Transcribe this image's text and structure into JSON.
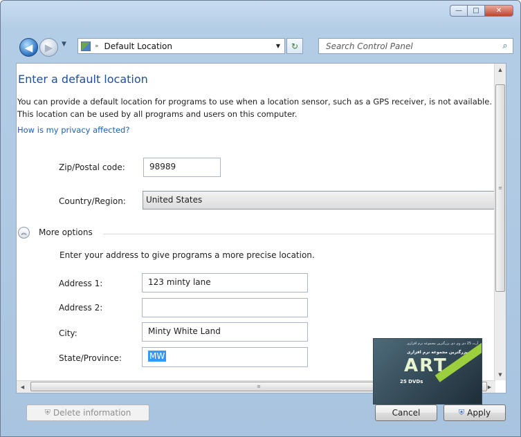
{
  "window": {
    "minimize_glyph": "—",
    "maximize_glyph": "□",
    "close_glyph": "✕"
  },
  "nav": {
    "back_glyph": "◀",
    "forward_glyph": "▶",
    "history_dropdown_glyph": "▼",
    "address_separator": "»",
    "address_text": "Default Location",
    "address_dropdown_glyph": "▼",
    "refresh_glyph": "↻",
    "search_placeholder": "Search Control Panel",
    "search_glyph": "⌕"
  },
  "page": {
    "title": "Enter a default location",
    "description": "You can provide a default location for programs to use when a location sensor, such as a GPS receiver, is not available. This location can be used by all programs and users on this computer.",
    "privacy_link": "How is my privacy affected?",
    "zip_label": "Zip/Postal code:",
    "zip_value": "98989",
    "country_label": "Country/Region:",
    "country_value": "United States",
    "more_options_glyph": "︽",
    "more_options_label": "More options",
    "more_options_desc": "Enter your address to give programs a more precise location.",
    "address1_label": "Address 1:",
    "address1_value": "123 minty lane",
    "address2_label": "Address 2:",
    "address2_value": "",
    "city_label": "City:",
    "city_value": "Minty White Land",
    "state_label": "State/Province:",
    "state_value": "MW"
  },
  "scroll": {
    "up_glyph": "▲",
    "down_glyph": "▼",
    "left_glyph": "◀",
    "right_glyph": "▶",
    "grip_glyph": "≡"
  },
  "ad": {
    "line1": "آرت 25 دی وی دی بزرگترین مجموعه نرم افزاری",
    "line2": "بزرگترین مجموعه نرم افزاری",
    "logo": "ART",
    "dvds": "25 DVDs"
  },
  "buttons": {
    "delete_label": "Delete information",
    "cancel_label": "Cancel",
    "apply_label": "Apply",
    "shield_glyph": "⛨"
  },
  "colors": {
    "title_blue": "#1f4e9b",
    "link_blue": "#1c5fb5",
    "selection_blue": "#3399ff",
    "frame_blue": "#b4cde6"
  }
}
